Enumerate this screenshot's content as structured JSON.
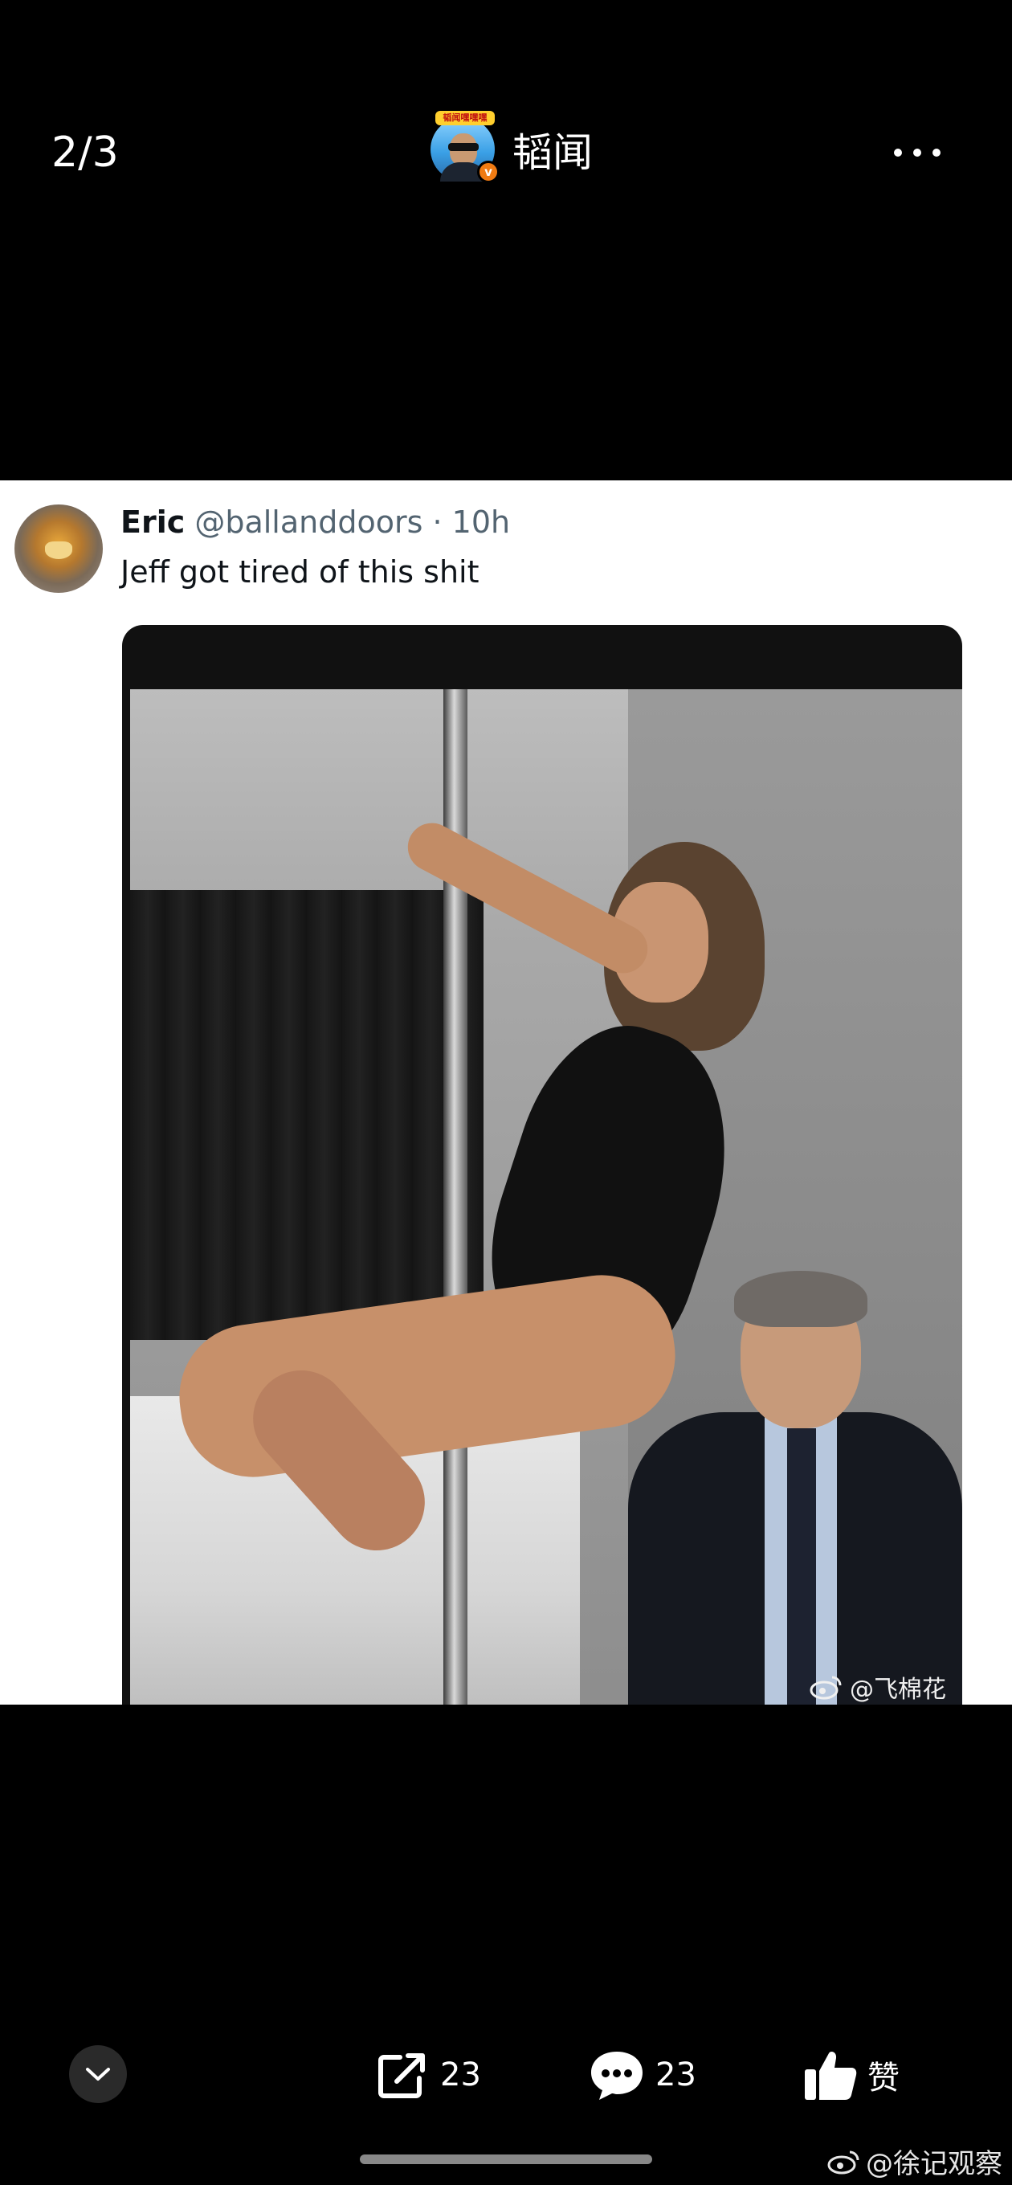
{
  "header": {
    "page_counter": "2/3",
    "author_name": "韬闻",
    "avatar_banner_text": "韬闻嘿嘿嘿",
    "verify_badge": "v"
  },
  "tweet": {
    "name": "Eric",
    "handle": "@ballanddoors",
    "separator": " · ",
    "time": "10h",
    "text": "Jeff got tired of this shit",
    "image_watermark": "@飞棉花"
  },
  "actions": {
    "share_count": "23",
    "comment_count": "23",
    "like_label": "赞"
  },
  "footer": {
    "account_watermark": "@徐记观察"
  },
  "colors": {
    "background": "#000000",
    "tweet_text": "#0f1419",
    "tweet_handle": "#536471",
    "verify_badge": "#f07b12"
  },
  "icons": [
    "more-icon",
    "chevron-down-icon",
    "share-icon",
    "comment-icon",
    "thumbs-up-icon",
    "weibo-icon"
  ]
}
